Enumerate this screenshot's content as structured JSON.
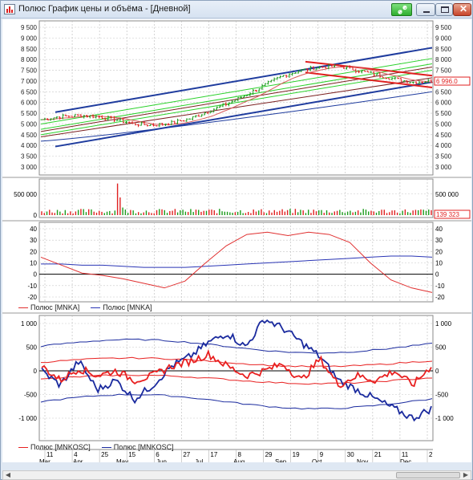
{
  "window": {
    "title": "Полюс График цены и объёма - [Дневной]",
    "buttons": {
      "sync": "link-icon",
      "minimize": "minimize-icon",
      "maximize": "maximize-icon",
      "close": "✕"
    }
  },
  "colors": {
    "price_up": "#1c9b1c",
    "price_down": "#e02020",
    "channel_outer": "#1f3c9e",
    "channel_green": "#2bd12b",
    "channel_mid": "#7a1f1f",
    "sma_red": "#d85a5a",
    "mnka_red": "#e03030",
    "mnka_blue": "#2a35b5",
    "osc_red": "#e82020",
    "osc_blue": "#1a2a9e"
  },
  "price_panel": {
    "y_ticks": [
      "9 500",
      "9 000",
      "8 500",
      "8 000",
      "7 500",
      "7 000",
      "6 500",
      "6 000",
      "5 500",
      "5 000",
      "4 500",
      "4 000",
      "3 500",
      "3 000"
    ],
    "last_price_label": "6 996.0"
  },
  "volume_panel": {
    "y_ticks": [
      "500 000",
      "0"
    ],
    "last_volume_label": "139 323"
  },
  "mnka_panel": {
    "y_ticks": [
      "40",
      "30",
      "20",
      "10",
      "0",
      "-10",
      "-20"
    ],
    "legend": [
      {
        "label": "Полюс [MNKA]",
        "color": "#e03030"
      },
      {
        "label": "Полюс [MNKA]",
        "color": "#2a35b5"
      }
    ]
  },
  "osc_panel": {
    "y_ticks": [
      "1 000",
      "500",
      "0",
      "-500",
      "-1 000"
    ],
    "legend": [
      {
        "label": "Полюс [MNKOSC]",
        "color": "#e82020"
      },
      {
        "label": "Полюс [MNKOSC]",
        "color": "#1a2a9e"
      }
    ]
  },
  "x_axis": {
    "days": [
      "11",
      "4",
      "25",
      "15",
      "6",
      "27",
      "17",
      "8",
      "29",
      "19",
      "9",
      "30",
      "21",
      "11",
      "2"
    ],
    "months": [
      "Mar",
      "Apr",
      "May",
      "Jun",
      "Jul",
      "Aug",
      "Sep",
      "Oct",
      "Nov",
      "Dec"
    ]
  },
  "chart_data": [
    {
      "type": "line",
      "title": "",
      "xlabel": "",
      "ylabel": "",
      "ylim": [
        3000,
        9500
      ],
      "series": [
        {
          "values": [
            5200,
            5350,
            5400,
            5350,
            5200,
            5000,
            4950,
            5050,
            5250,
            5600,
            5950,
            6350,
            6800,
            7250,
            7500,
            7650,
            7700,
            7500,
            7300,
            7100,
            6950,
            6996
          ]
        }
      ],
      "last": 6996.0
    },
    {
      "type": "bar",
      "title": "",
      "ylim": [
        0,
        800000
      ],
      "note_peak": 750000,
      "last": 139323
    },
    {
      "type": "line",
      "title": "",
      "ylim": [
        -20,
        40
      ],
      "legend": [
        "Полюс [MNKA]",
        "Полюс [MNKA]"
      ],
      "series": [
        {
          "values": [
            15,
            8,
            1,
            -1,
            -4,
            -8,
            -12,
            -6,
            10,
            25,
            35,
            37,
            34,
            37,
            35,
            28,
            10,
            -5,
            -12,
            -16
          ]
        },
        {
          "values": [
            9,
            9,
            8,
            8,
            7,
            6,
            6,
            6,
            7,
            8,
            9,
            10,
            11,
            12,
            13,
            14,
            15,
            16,
            16,
            15
          ]
        }
      ]
    },
    {
      "type": "line",
      "title": "",
      "ylim": [
        -1000,
        1000
      ],
      "legend": [
        "Полюс [MNKOSC]",
        "Полюс [MNKOSC]"
      ],
      "series": [
        {
          "values": [
            100,
            -200,
            50,
            -100,
            0,
            -200,
            -100,
            100,
            200,
            350,
            100,
            -100,
            0,
            150,
            -200,
            250,
            -300,
            -100,
            -200,
            0,
            -300,
            100
          ]
        },
        {
          "values": [
            0,
            -300,
            200,
            -400,
            -200,
            -600,
            -300,
            100,
            300,
            600,
            800,
            500,
            1100,
            900,
            600,
            300,
            -200,
            -400,
            -600,
            -800,
            -1000,
            -800
          ]
        }
      ]
    }
  ]
}
